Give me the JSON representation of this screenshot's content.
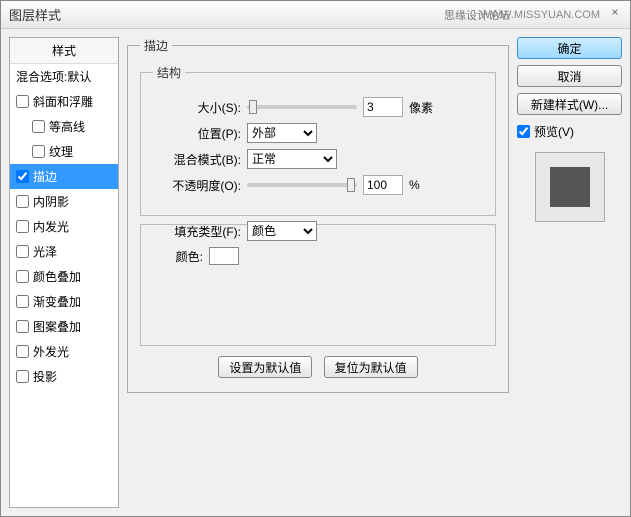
{
  "window": {
    "title": "图层样式",
    "watermark_site": "思缘设计论坛",
    "watermark_url": "WWW.MISSYUAN.COM",
    "close": "×"
  },
  "sidebar": {
    "heading": "样式",
    "blend": "混合选项:默认",
    "items": [
      {
        "label": "斜面和浮雕",
        "checked": false,
        "indent": false
      },
      {
        "label": "等高线",
        "checked": false,
        "indent": true
      },
      {
        "label": "纹理",
        "checked": false,
        "indent": true
      },
      {
        "label": "描边",
        "checked": true,
        "indent": false,
        "selected": true
      },
      {
        "label": "内阴影",
        "checked": false,
        "indent": false
      },
      {
        "label": "内发光",
        "checked": false,
        "indent": false
      },
      {
        "label": "光泽",
        "checked": false,
        "indent": false
      },
      {
        "label": "颜色叠加",
        "checked": false,
        "indent": false
      },
      {
        "label": "渐变叠加",
        "checked": false,
        "indent": false
      },
      {
        "label": "图案叠加",
        "checked": false,
        "indent": false
      },
      {
        "label": "外发光",
        "checked": false,
        "indent": false
      },
      {
        "label": "投影",
        "checked": false,
        "indent": false
      }
    ]
  },
  "panel": {
    "title": "描边",
    "structure_legend": "结构",
    "size_label": "大小(S):",
    "size_value": "3",
    "size_unit": "像素",
    "position_label": "位置(P):",
    "position_value": "外部",
    "blend_label": "混合模式(B):",
    "blend_value": "正常",
    "opacity_label": "不透明度(O):",
    "opacity_value": "100",
    "opacity_unit": "%",
    "fill_label": "填充类型(F):",
    "fill_value": "颜色",
    "color_label": "颜色:",
    "btn_default": "设置为默认值",
    "btn_reset": "复位为默认值"
  },
  "right": {
    "ok": "确定",
    "cancel": "取消",
    "newstyle": "新建样式(W)...",
    "preview_label": "预览(V)",
    "preview_checked": true
  }
}
